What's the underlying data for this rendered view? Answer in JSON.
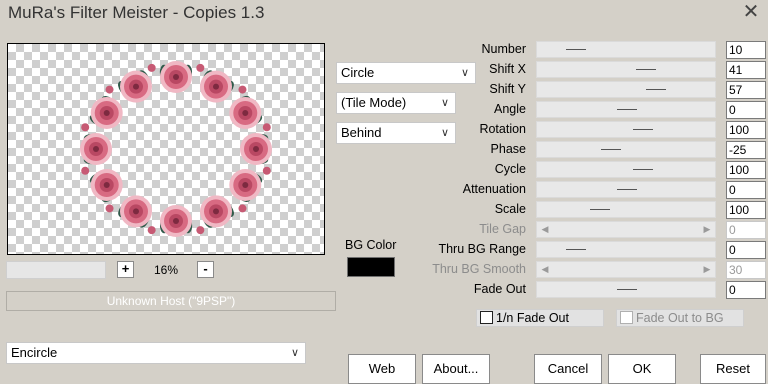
{
  "window": {
    "title": "MuRa's Filter Meister - Copies 1.3",
    "close_icon": "close-icon"
  },
  "preview": {
    "zoom_label": "16%",
    "zoom_plus": "+",
    "zoom_minus": "-",
    "host_text": "Unknown Host (\"9PSP\")"
  },
  "dropdowns": {
    "shape": "Circle",
    "mode": "(Tile Mode)",
    "placement": "Behind",
    "preset": "Encircle"
  },
  "params": [
    {
      "label": "Number",
      "value": "10",
      "level": 0.18,
      "disabled": false
    },
    {
      "label": "Shift X",
      "value": "41",
      "level": 0.62,
      "disabled": false
    },
    {
      "label": "Shift Y",
      "value": "57",
      "level": 0.68,
      "disabled": false
    },
    {
      "label": "Angle",
      "value": "0",
      "level": 0.5,
      "disabled": false
    },
    {
      "label": "Rotation",
      "value": "100",
      "level": 0.6,
      "disabled": false
    },
    {
      "label": "Phase",
      "value": "-25",
      "level": 0.4,
      "disabled": false
    },
    {
      "label": "Cycle",
      "value": "100",
      "level": 0.6,
      "disabled": false
    },
    {
      "label": "Attenuation",
      "value": "0",
      "level": 0.5,
      "disabled": false
    },
    {
      "label": "Scale",
      "value": "100",
      "level": 0.33,
      "disabled": false
    },
    {
      "label": "Tile Gap",
      "value": "0",
      "level": 0,
      "disabled": true
    },
    {
      "label": "Thru BG Range",
      "value": "0",
      "level": 0.18,
      "disabled": false
    },
    {
      "label": "Thru BG Smooth",
      "value": "30",
      "level": 0,
      "disabled": true
    },
    {
      "label": "Fade Out",
      "value": "0",
      "level": 0.5,
      "disabled": false
    }
  ],
  "bg_color": {
    "label": "BG Color",
    "color": "#000000"
  },
  "checkboxes": {
    "fade_out_n": {
      "label": "1/n Fade Out",
      "checked": false
    },
    "fade_out_bg": {
      "label": "Fade Out to BG",
      "checked": false
    }
  },
  "buttons": {
    "web": "Web",
    "about": "About...",
    "cancel": "Cancel",
    "ok": "OK",
    "reset": "Reset"
  },
  "icons": {
    "dropdown_chevron": "chevron-down-icon",
    "slider_left": "arrow-left-icon",
    "slider_right": "arrow-right-icon"
  },
  "colors": {
    "window_bg": "#d4d0c8",
    "rose_pink": "#d86a82",
    "leaf_green": "#2f5a4a"
  }
}
